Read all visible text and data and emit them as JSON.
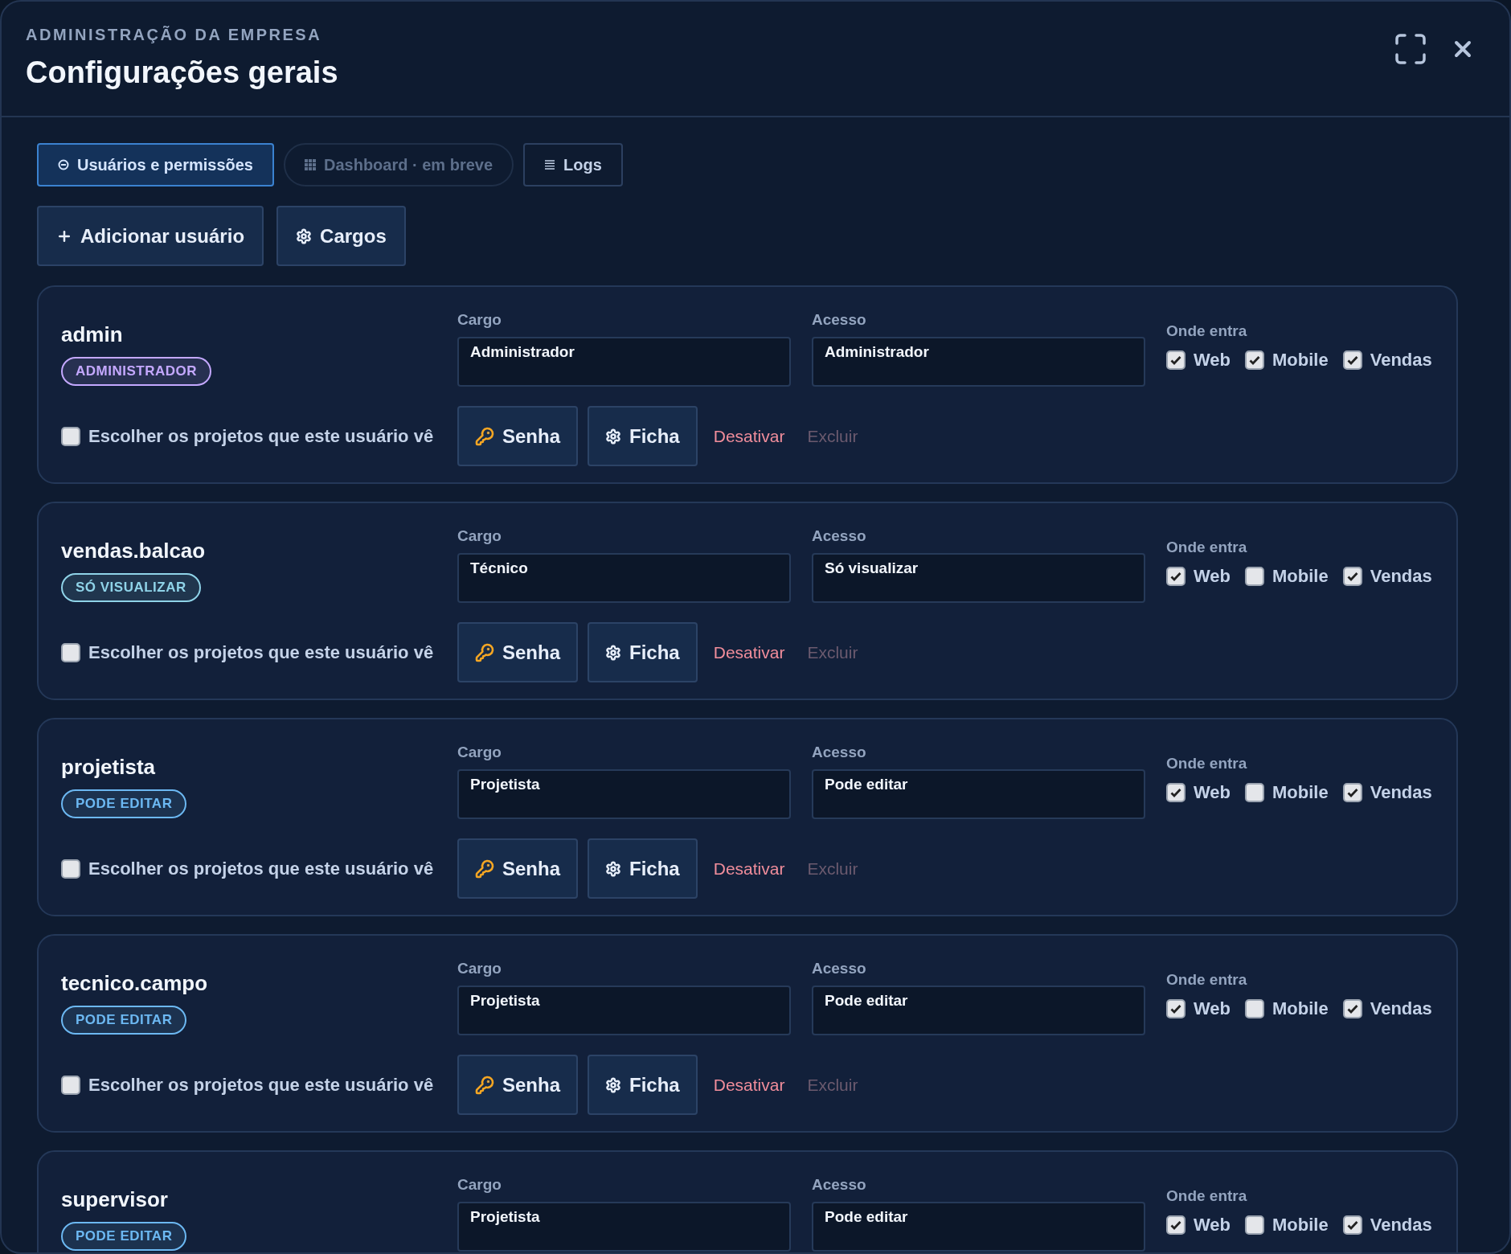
{
  "header": {
    "eyebrow": "ADMINISTRAÇÃO DA EMPRESA",
    "title": "Configurações gerais"
  },
  "tabs": [
    {
      "label": "Usuários e permissões",
      "kind": "users",
      "selected": true,
      "disabled": false
    },
    {
      "label": "Dashboard · em breve",
      "kind": "grid",
      "selected": false,
      "disabled": true
    },
    {
      "label": "Logs",
      "kind": "list",
      "selected": false,
      "disabled": false
    }
  ],
  "actions": [
    {
      "label": "Adicionar usuário",
      "kind": "add"
    },
    {
      "label": "Cargos",
      "kind": "settings"
    }
  ],
  "users": [
    {
      "name": "admin",
      "badge": {
        "label": "ADMINISTRADOR",
        "color": "#c4a8ff"
      },
      "cargo": {
        "label": "Cargo",
        "value": "Administrador"
      },
      "acesso": {
        "label": "Acesso",
        "value": "Administrador"
      },
      "where_label": "Onde entra",
      "channels": [
        {
          "label": "Web",
          "checked": true
        },
        {
          "label": "Mobile",
          "checked": true
        },
        {
          "label": "Vendas",
          "checked": true
        }
      ],
      "projects": {
        "label": "Escolher os projetos que este usuário vê",
        "checked": false
      },
      "buttons": {
        "senha": "Senha",
        "ficha": "Ficha",
        "desativar": "Desativar",
        "excluir": "Excluir"
      }
    },
    {
      "name": "vendas.balcao",
      "badge": {
        "label": "SÓ VISUALIZAR",
        "color": "#8fd3e8"
      },
      "cargo": {
        "label": "Cargo",
        "value": "Técnico"
      },
      "acesso": {
        "label": "Acesso",
        "value": "Só visualizar"
      },
      "where_label": "Onde entra",
      "channels": [
        {
          "label": "Web",
          "checked": true
        },
        {
          "label": "Mobile",
          "checked": false
        },
        {
          "label": "Vendas",
          "checked": true
        }
      ],
      "projects": {
        "label": "Escolher os projetos que este usuário vê",
        "checked": false
      },
      "buttons": {
        "senha": "Senha",
        "ficha": "Ficha",
        "desativar": "Desativar",
        "excluir": "Excluir"
      }
    },
    {
      "name": "projetista",
      "badge": {
        "label": "PODE EDITAR",
        "color": "#6cb8f2"
      },
      "cargo": {
        "label": "Cargo",
        "value": "Projetista"
      },
      "acesso": {
        "label": "Acesso",
        "value": "Pode editar"
      },
      "where_label": "Onde entra",
      "channels": [
        {
          "label": "Web",
          "checked": true
        },
        {
          "label": "Mobile",
          "checked": false
        },
        {
          "label": "Vendas",
          "checked": true
        }
      ],
      "projects": {
        "label": "Escolher os projetos que este usuário vê",
        "checked": false
      },
      "buttons": {
        "senha": "Senha",
        "ficha": "Ficha",
        "desativar": "Desativar",
        "excluir": "Excluir"
      }
    },
    {
      "name": "tecnico.campo",
      "badge": {
        "label": "PODE EDITAR",
        "color": "#6cb8f2"
      },
      "cargo": {
        "label": "Cargo",
        "value": "Projetista"
      },
      "acesso": {
        "label": "Acesso",
        "value": "Pode editar"
      },
      "where_label": "Onde entra",
      "channels": [
        {
          "label": "Web",
          "checked": true
        },
        {
          "label": "Mobile",
          "checked": false
        },
        {
          "label": "Vendas",
          "checked": true
        }
      ],
      "projects": {
        "label": "Escolher os projetos que este usuário vê",
        "checked": false
      },
      "buttons": {
        "senha": "Senha",
        "ficha": "Ficha",
        "desativar": "Desativar",
        "excluir": "Excluir"
      }
    },
    {
      "name": "supervisor",
      "badge": {
        "label": "PODE EDITAR",
        "color": "#6cb8f2"
      },
      "cargo": {
        "label": "Cargo",
        "value": "Projetista"
      },
      "acesso": {
        "label": "Acesso",
        "value": "Pode editar"
      },
      "where_label": "Onde entra",
      "channels": [
        {
          "label": "Web",
          "checked": true
        },
        {
          "label": "Mobile",
          "checked": false
        },
        {
          "label": "Vendas",
          "checked": true
        }
      ]
    }
  ]
}
